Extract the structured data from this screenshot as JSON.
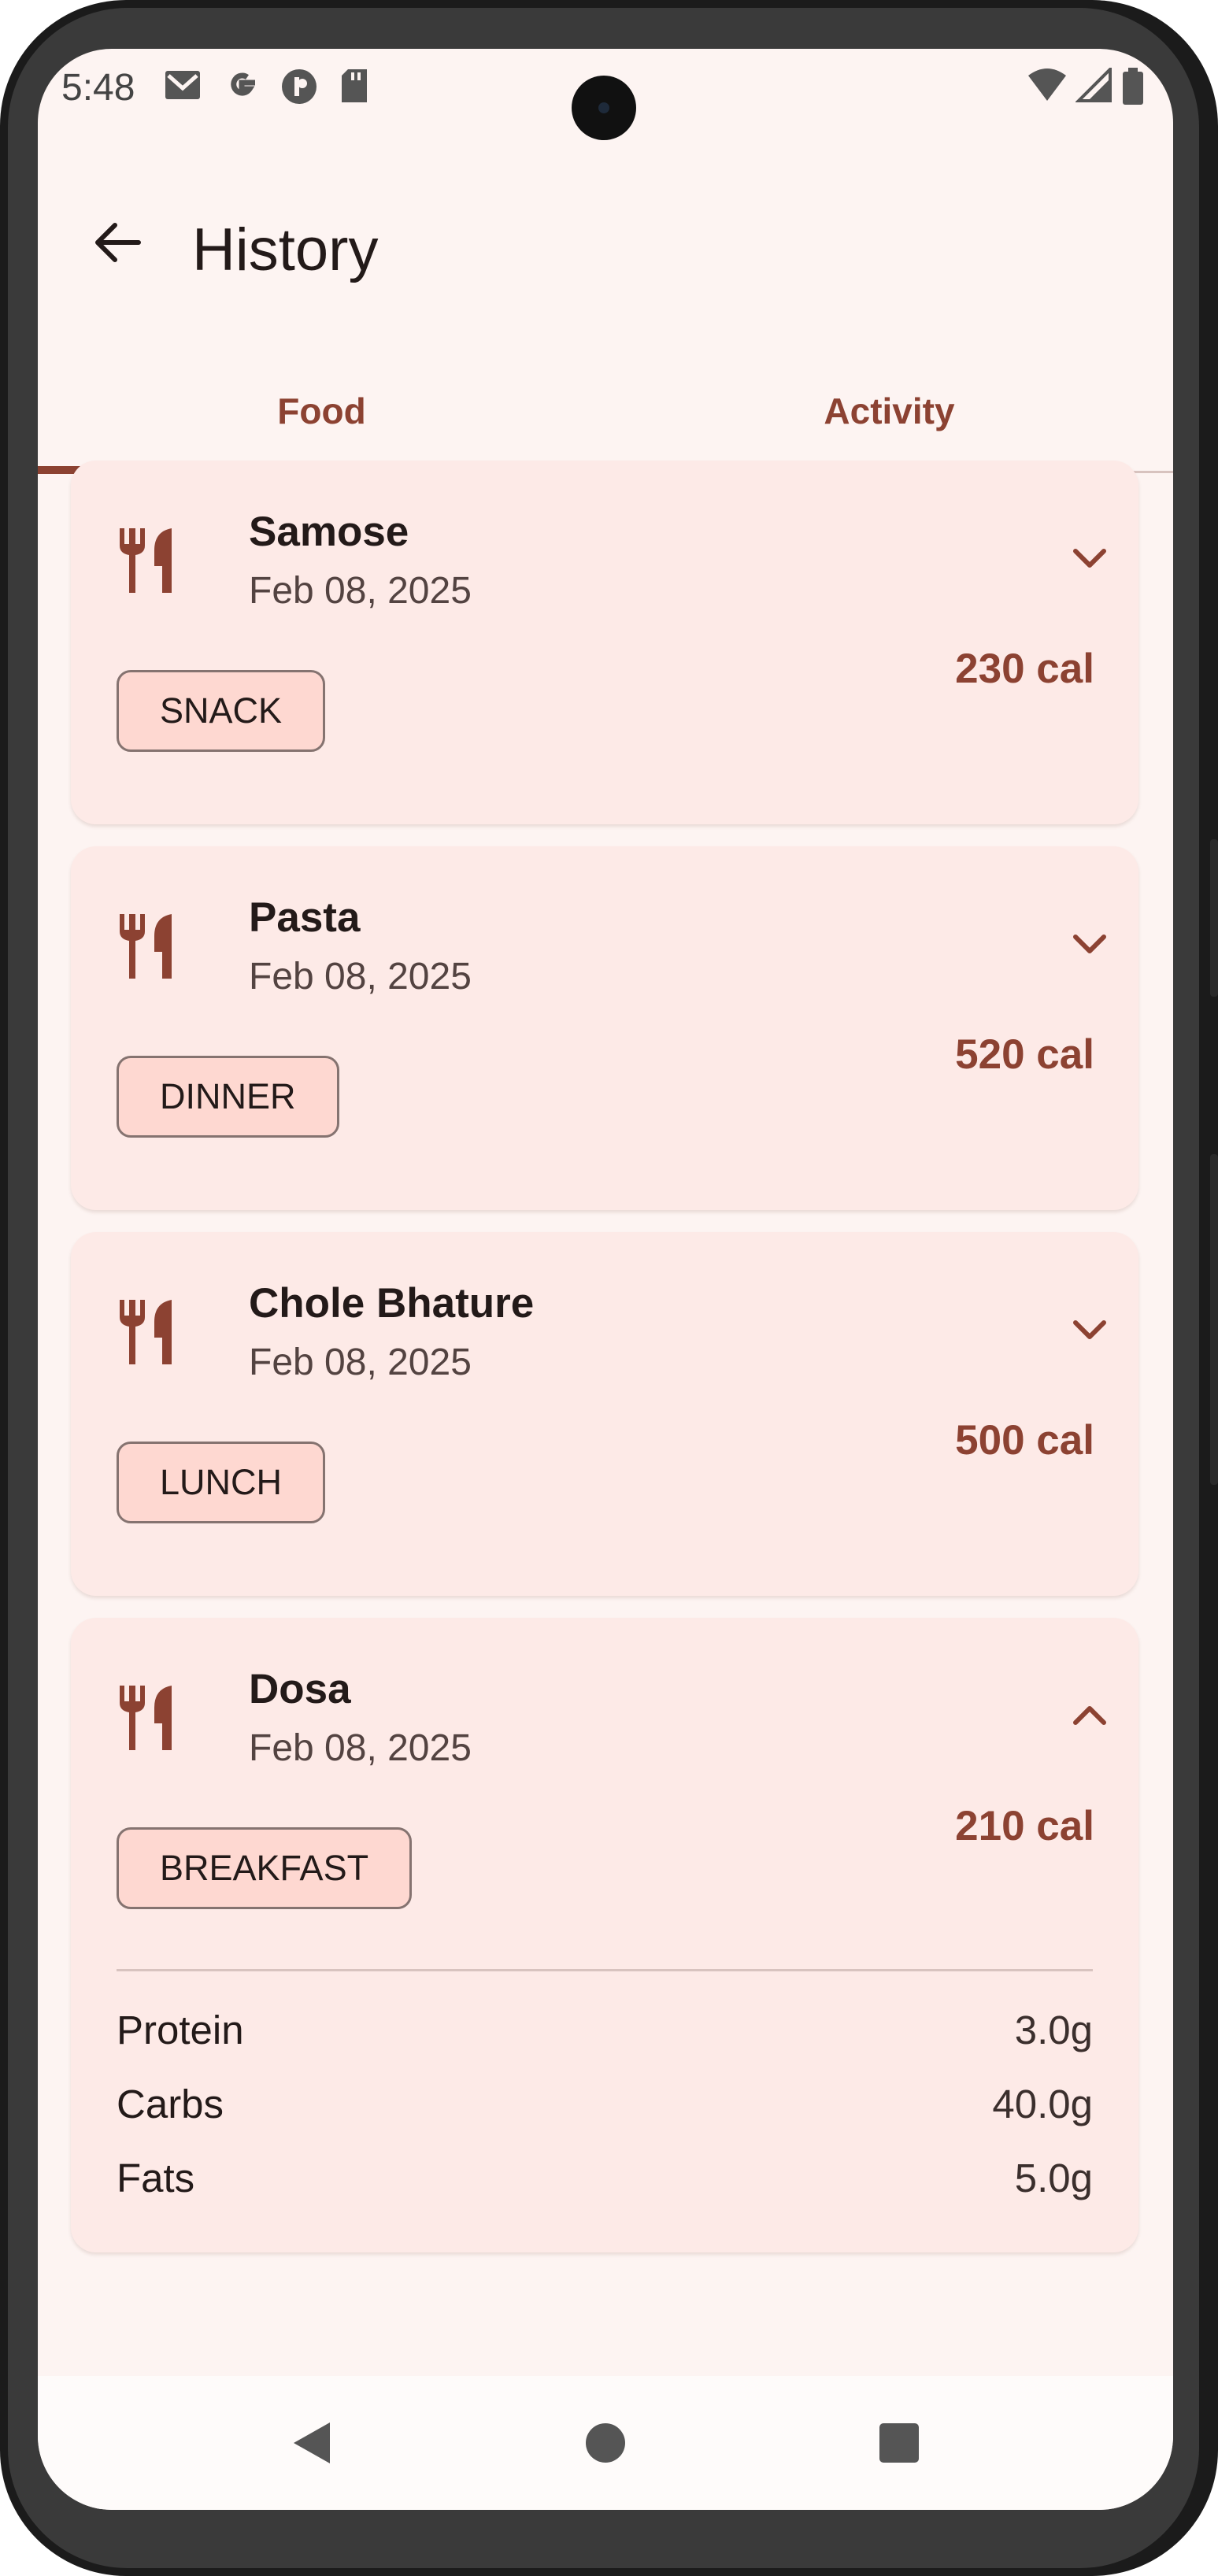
{
  "status_bar": {
    "time": "5:48",
    "left_icons": [
      "gmail-icon",
      "google-icon",
      "app-icon",
      "sd-card-icon"
    ],
    "right_icons": [
      "wifi-icon",
      "signal-icon",
      "battery-icon"
    ]
  },
  "app_bar": {
    "title": "History",
    "back_icon": "arrow-back-icon"
  },
  "tabs": [
    {
      "label": "Food",
      "selected": true
    },
    {
      "label": "Activity",
      "selected": false
    }
  ],
  "entries": [
    {
      "name": "Samose",
      "date": "Feb 08, 2025",
      "meal": "SNACK",
      "calories": "230 cal",
      "expanded": false
    },
    {
      "name": "Pasta",
      "date": "Feb 08, 2025",
      "meal": "DINNER",
      "calories": "520 cal",
      "expanded": false
    },
    {
      "name": "Chole Bhature",
      "date": "Feb 08, 2025",
      "meal": "LUNCH",
      "calories": "500 cal",
      "expanded": false
    },
    {
      "name": "Dosa",
      "date": "Feb 08, 2025",
      "meal": "BREAKFAST",
      "calories": "210 cal",
      "expanded": true,
      "nutrients": [
        {
          "label": "Protein",
          "value": "3.0g"
        },
        {
          "label": "Carbs",
          "value": "40.0g"
        },
        {
          "label": "Fats",
          "value": "5.0g"
        }
      ]
    }
  ],
  "nav_bar": {
    "icons": [
      "back-triangle-icon",
      "home-circle-icon",
      "recents-square-icon"
    ]
  },
  "colors": {
    "background": "#fdf4f2",
    "card": "#fdeae7",
    "accent": "#8c4232",
    "chip": "#fed8d1"
  }
}
